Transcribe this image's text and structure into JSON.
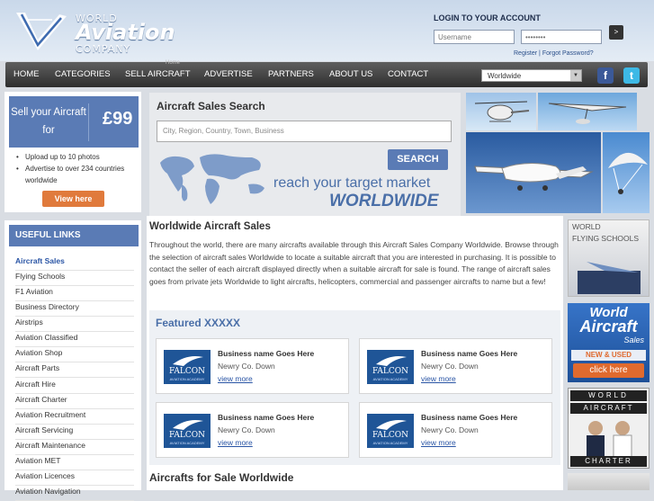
{
  "header": {
    "logo": {
      "line1": "WORLD",
      "line2": "Aviation",
      "line3": "COMPANY"
    },
    "login": {
      "title": "LOGIN TO YOUR ACCOUNT",
      "username_placeholder": "Username",
      "password_placeholder": "••••••••",
      "go_label": ">",
      "register_label": "Register",
      "separator": "|",
      "forgot_label": "Forgot Password?"
    }
  },
  "nav": {
    "items": [
      "HOME",
      "CATEGORIES",
      "SELL AIRCRAFT",
      "ADVERTISE",
      "PARTNERS",
      "ABOUT US",
      "CONTACT"
    ],
    "tooltip": "Home",
    "region_selected": "Worldwide",
    "social": {
      "facebook": "facebook-icon",
      "twitter": "twitter-icon"
    }
  },
  "sell": {
    "text": "Sell your Aircraft for",
    "price": "£99",
    "bullets": [
      "Upload up to 10 photos",
      "Advertise to over 234 countries worldwide"
    ],
    "button": "View here"
  },
  "useful_links": {
    "title": "USEFUL LINKS",
    "items": [
      "Aircraft Sales",
      "Flying Schools",
      "F1 Aviation",
      "Business Directory",
      "Airstrips",
      "Aviation Classified",
      "Aviation Shop",
      "Aircraft Parts",
      "Aircraft Hire",
      "Aircraft Charter",
      "Aviation Recruitment",
      "Aircraft Servicing",
      "Aircraft Maintenance",
      "Aviation MET",
      "Aviation Licences",
      "Aviation Navigation"
    ]
  },
  "search": {
    "title": "Aircraft Sales Search",
    "placeholder": "City, Region, Country, Town, Business",
    "button": "SEARCH",
    "tagline1": "reach your target market",
    "tagline2": "WORLDWIDE"
  },
  "content": {
    "title": "Worldwide Aircraft Sales",
    "body": "Throughout the world, there are many aircrafts available through this Aircraft Sales Company Worldwide. Browse through the selection of aircraft sales Worldwide to locate a suitable aircraft that you are interested in purchasing. It is possible to contact the seller of each aircraft displayed directly when a suitable aircraft for sale is found. The range of aircraft sales goes from private jets Worldwide to light aircrafts, helicopters, commercial and passenger aircrafts to name but a few!",
    "featured_title": "Featured XXXXX",
    "cards": [
      {
        "name": "Business name Goes Here",
        "location": "Newry Co. Down",
        "more": "view more",
        "logo": "FALCON",
        "logo_sub": "AVIATION ACADEMY"
      },
      {
        "name": "Business name Goes Here",
        "location": "Newry Co. Down",
        "more": "view more",
        "logo": "FALCON",
        "logo_sub": "AVIATION ACADEMY"
      },
      {
        "name": "Business name Goes Here",
        "location": "Newry Co. Down",
        "more": "view more",
        "logo": "FALCON",
        "logo_sub": "AVIATION ACADEMY"
      },
      {
        "name": "Business name Goes Here",
        "location": "Newry Co. Down",
        "more": "view more",
        "logo": "FALCON",
        "logo_sub": "AVIATION ACADEMY"
      }
    ],
    "sale_title": "Aircrafts for Sale Worldwide"
  },
  "ads": {
    "flying_schools": {
      "line1": "WORLD",
      "line2": "FLYING SCHOOLS"
    },
    "aircraft_sales": {
      "line1": "World",
      "line2": "Aircraft",
      "line3": "Sales",
      "line4": "NEW & USED",
      "button": "click here"
    },
    "charter": {
      "line1": "WORLD",
      "line2": "AIRCRAFT",
      "line3": "CHARTER"
    }
  }
}
